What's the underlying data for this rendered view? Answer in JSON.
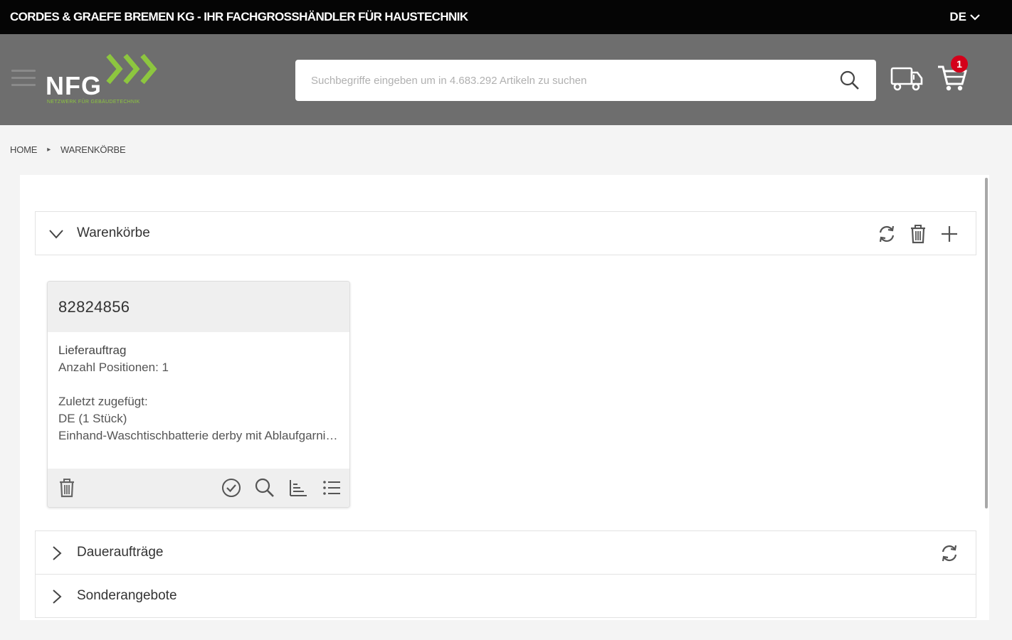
{
  "topbar": {
    "company": "CORDES & GRAEFE BREMEN KG - IHR FACHGROSSHÄNDLER FÜR HAUSTECHNIK",
    "language": "DE"
  },
  "header": {
    "logo_text": "NFG",
    "logo_tagline": "NETZWERK FÜR GEBÄUDETECHNIK",
    "search_placeholder": "Suchbegriffe eingeben um in 4.683.292 Artikeln zu suchen",
    "cart_count": "1",
    "brand_color": "#8dc63f"
  },
  "breadcrumb": {
    "home": "HOME",
    "current": "WARENKÖRBE"
  },
  "sections": {
    "warenkoerbe": "Warenkörbe",
    "dauerauftraege": "Daueraufträge",
    "sonderangebote": "Sonderangebote"
  },
  "basket": {
    "number": "82824856",
    "type": "Lieferauftrag",
    "positions": "Anzahl Positionen: 1",
    "last_added_label": "Zuletzt zugefügt:",
    "last_added_item": "DE (1 Stück)",
    "last_added_desc": "Einhand-Waschtischbatterie derby mit Ablaufgarnitur"
  }
}
